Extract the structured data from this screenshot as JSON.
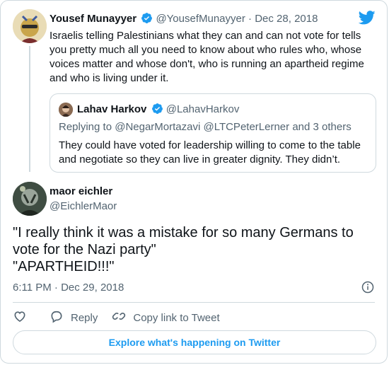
{
  "parent_tweet": {
    "name": "Yousef Munayyer",
    "handle": "@YousefMunayyer",
    "date": "Dec 28, 2018",
    "separator": "·",
    "text": "Israelis telling Palestinians what they can and can not vote for tells you pretty much all you need to know about who rules who, whose voices matter and whose don't, who is running an apartheid regime and who is living under it."
  },
  "quoted_tweet": {
    "name": "Lahav Harkov",
    "handle": "@LahavHarkov",
    "replying_prefix": "Replying to",
    "replying_to": "@NegarMortazavi @LTCPeterLerner and 3 others",
    "text": "They could have voted for leadership willing to come to the table and negotiate so they can live in greater dignity. They didn’t."
  },
  "main_tweet": {
    "name": "maor eichler",
    "handle": "@EichlerMaor",
    "lines": [
      "\"I really think it was a mistake for so many Germans to",
      "vote for the Nazi party\"",
      "\"APARTHEID!!!\""
    ],
    "timestamp": "6:11 PM · Dec 29, 2018"
  },
  "actions": {
    "reply": "Reply",
    "copy_link": "Copy link to Tweet"
  },
  "explore_button": "Explore what's happening on Twitter",
  "colors": {
    "twitter_blue": "#1d9bf0",
    "secondary_text": "#536471",
    "border": "#cfd9de"
  },
  "icons": [
    "verified-badge-icon",
    "twitter-bird-icon",
    "info-icon",
    "heart-icon",
    "reply-icon",
    "copy-link-icon"
  ]
}
